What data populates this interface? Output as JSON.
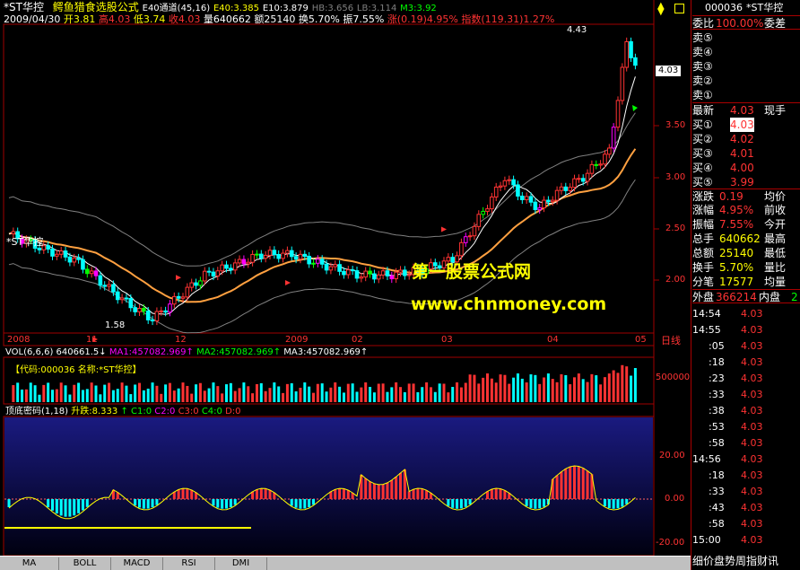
{
  "colors": {
    "up": "#ff3333",
    "down": "#00ffff",
    "ma": "#ffffff",
    "band": "#ffa040",
    "grid": "#a00000",
    "yellow": "#ffff00",
    "green": "#00ff00",
    "magenta": "#ff00ff"
  },
  "header": {
    "stock": "*ST华控",
    "formula": "鳄鱼猎食选股公式",
    "channel": "E40通道(45,16)",
    "e40": "E40:3.385",
    "e10": "E10:3.879",
    "hb": "HB:3.656",
    "lb": "LB:3.114",
    "m3": "M3:3.92",
    "date": "2009/04/30",
    "open": "开3.81",
    "high": "高4.03",
    "low": "低3.74",
    "close": "收4.03",
    "volume": "量640662",
    "amount": "额25140",
    "turnover": "换5.70%",
    "amplitude": "振7.55%",
    "rise": "涨(0.19)4.95%",
    "index": "指数(119.31)1.27%"
  },
  "main": {
    "y_ticks": [
      "4.03",
      "3.50",
      "3.00",
      "2.50",
      "2.00"
    ],
    "peak_label": "4.43",
    "low_label": "1.58",
    "stock_label": "*ST华控",
    "x_labels": [
      "2008",
      "11",
      "12",
      "2009",
      "02",
      "03",
      "04",
      "05"
    ],
    "period": "日线",
    "watermark1": "第一股票公式网",
    "watermark2": "www.chnmoney.com"
  },
  "vol": {
    "title": "VOL(6,6,6)",
    "v": "640661.5",
    "ma1": "MA1:457082.969",
    "ma2": "MA2:457082.969",
    "ma3": "MA3:457082.969",
    "info": "【代码:000036  名称:*ST华控】",
    "y_tick": "500000"
  },
  "ind": {
    "title": "顶底密码(1,18)",
    "rise": "升跌:8.333",
    "c1": "C1:0",
    "c2": "C2:0",
    "c3": "C3:0",
    "c4": "C4:0",
    "d": "D:0",
    "y_ticks": [
      "20.00",
      "0.00",
      "-20.00"
    ]
  },
  "tabs": [
    "MA",
    "BOLL",
    "MACD",
    "RSI",
    "DMI"
  ],
  "sidebar": {
    "code": "000036",
    "name": "*ST华控",
    "wei_label": "委比",
    "wei_value": "100.00%",
    "wei_cha": "委差",
    "asks": [
      "卖⑤",
      "卖④",
      "卖③",
      "卖②",
      "卖①"
    ],
    "latest_label": "最新",
    "latest_value": "4.03",
    "now_label": "现手",
    "bids": [
      {
        "label": "买①",
        "value": "4.03"
      },
      {
        "label": "买②",
        "value": "4.02"
      },
      {
        "label": "买③",
        "value": "4.01"
      },
      {
        "label": "买④",
        "value": "4.00"
      },
      {
        "label": "买⑤",
        "value": "3.99"
      }
    ],
    "stats": [
      {
        "l": "涨跌",
        "v": "0.19",
        "r": "均价"
      },
      {
        "l": "涨幅",
        "v": "4.95%",
        "r": "前收"
      },
      {
        "l": "振幅",
        "v": "7.55%",
        "r": "今开"
      },
      {
        "l": "总手",
        "v": "640662",
        "r": "最高"
      },
      {
        "l": "总额",
        "v": "25140",
        "r": "最低"
      },
      {
        "l": "换手",
        "v": "5.70%",
        "r": "量比"
      },
      {
        "l": "分笔",
        "v": "17577",
        "r": "均量"
      }
    ],
    "outer_label": "外盘",
    "outer_value": "366214",
    "inner_label": "内盘",
    "inner_value": "2",
    "trades": [
      {
        "t": "14:54",
        "p": "4.03"
      },
      {
        "t": "14:55",
        "p": "4.03"
      },
      {
        "t": ":05",
        "p": "4.03"
      },
      {
        "t": ":18",
        "p": "4.03"
      },
      {
        "t": ":23",
        "p": "4.03"
      },
      {
        "t": ":33",
        "p": "4.03"
      },
      {
        "t": ":38",
        "p": "4.03"
      },
      {
        "t": ":53",
        "p": "4.03"
      },
      {
        "t": ":58",
        "p": "4.03"
      },
      {
        "t": "14:56",
        "p": "4.03"
      },
      {
        "t": ":18",
        "p": "4.03"
      },
      {
        "t": ":33",
        "p": "4.03"
      },
      {
        "t": ":43",
        "p": "4.03"
      },
      {
        "t": ":58",
        "p": "4.03"
      },
      {
        "t": "15:00",
        "p": "4.03"
      }
    ],
    "footer": "细价盘势周指财讯"
  }
}
